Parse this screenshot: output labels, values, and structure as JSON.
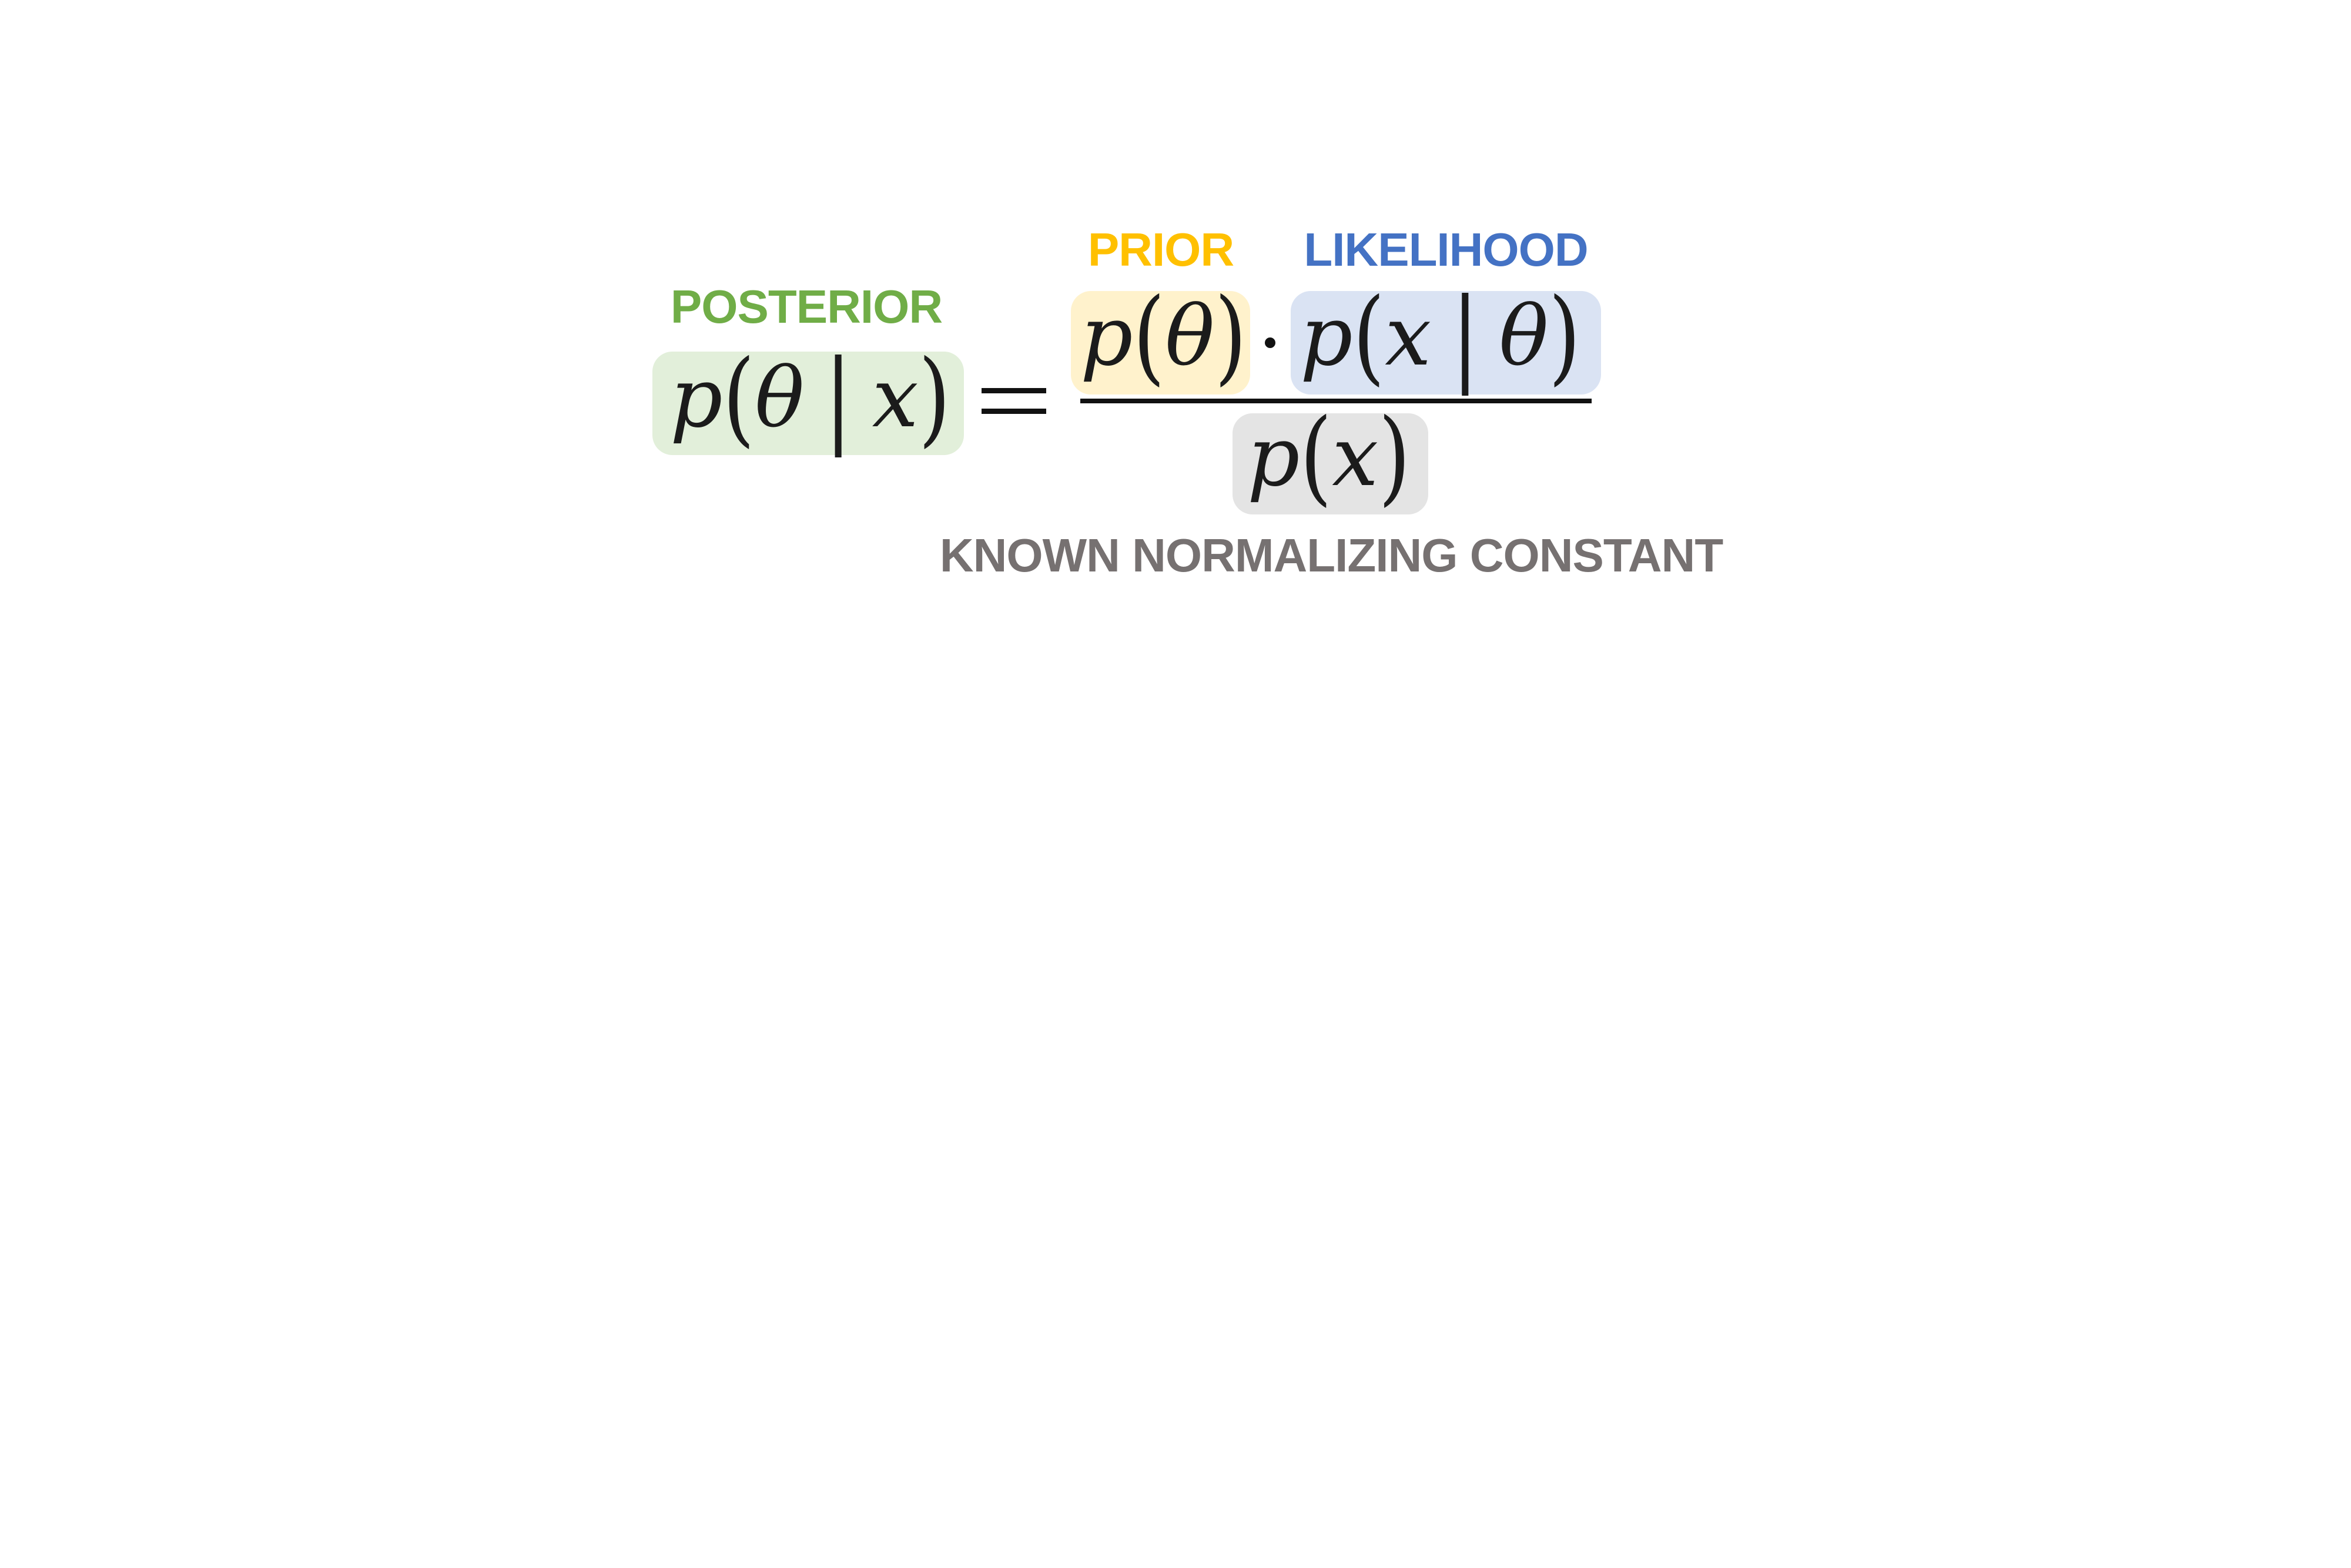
{
  "labels": {
    "posterior": "POSTERIOR",
    "prior": "PRIOR",
    "likelihood": "LIKELIHOOD",
    "evidence": "KNOWN NORMALIZING CONSTANT"
  },
  "terms": {
    "posterior": "p(θ | x)",
    "prior": "p(θ)",
    "likelihood": "p(x | θ)",
    "evidence": "p(x)"
  },
  "operators": {
    "equals": "=",
    "times": "·"
  },
  "colors": {
    "posterior_text": "#70AD47",
    "posterior_box": "#E2EFDA",
    "prior_text": "#FFC000",
    "prior_box": "#FFF2CC",
    "likelihood_text": "#4472C4",
    "likelihood_box": "#DAE3F3",
    "evidence_text": "#767171",
    "evidence_box": "#E4E4E4"
  }
}
